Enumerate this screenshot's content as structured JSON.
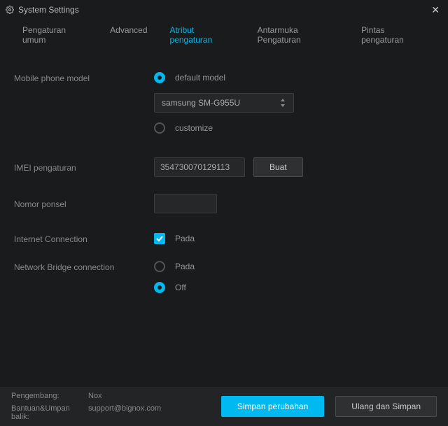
{
  "window": {
    "title": "System Settings"
  },
  "tabs": {
    "general": "Pengaturan umum",
    "advanced": "Advanced",
    "attributes": "Atribut pengaturan",
    "interface": "Antarmuka Pengaturan",
    "shortcuts": "Pintas pengaturan"
  },
  "labels": {
    "phone_model": "Mobile phone model",
    "imei": "IMEI pengaturan",
    "phone_number": "Nomor ponsel",
    "internet": "Internet Connection",
    "bridge": "Network Bridge connection"
  },
  "phone_model": {
    "default_label": "default model",
    "selected_device": "samsung SM-G955U",
    "customize_label": "customize"
  },
  "imei": {
    "value": "354730070129113",
    "generate_label": "Buat"
  },
  "phone_number": {
    "value": ""
  },
  "internet": {
    "on_label": "Pada"
  },
  "bridge": {
    "on_label": "Pada",
    "off_label": "Off"
  },
  "footer": {
    "developer_key": "Pengembang:",
    "developer_val": "Nox",
    "support_key": "Bantuan&Umpan balik:",
    "support_val": "support@bignox.com",
    "save_label": "Simpan perubahan",
    "restart_label": "Ulang dan Simpan"
  }
}
